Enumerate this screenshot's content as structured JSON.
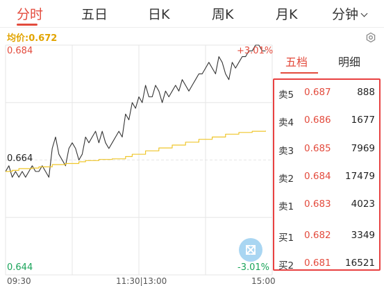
{
  "tabs": [
    {
      "label": "分时",
      "active": true
    },
    {
      "label": "五日",
      "active": false
    },
    {
      "label": "日K",
      "active": false
    },
    {
      "label": "周K",
      "active": false
    },
    {
      "label": "月K",
      "active": false
    },
    {
      "label": "分钟",
      "active": false
    }
  ],
  "avg_price_label": "均价:0.672",
  "chart": {
    "price_high": "0.684",
    "price_prev_close": "0.664",
    "price_low": "0.644",
    "pct_high": "+3.01%",
    "pct_low": "-3.01%",
    "times": [
      "09:30",
      "11:30|13:00",
      "15:00"
    ]
  },
  "chart_data": {
    "type": "line",
    "ylim": [
      0.644,
      0.684
    ],
    "reference_price": 0.664,
    "x_range_minutes": [
      0,
      240
    ],
    "series": [
      {
        "color": "#333333",
        "points": [
          [
            0,
            0.662
          ],
          [
            3,
            0.663
          ],
          [
            6,
            0.661
          ],
          [
            9,
            0.662
          ],
          [
            12,
            0.661
          ],
          [
            15,
            0.662
          ],
          [
            18,
            0.661
          ],
          [
            21,
            0.662
          ],
          [
            24,
            0.663
          ],
          [
            27,
            0.662
          ],
          [
            30,
            0.662
          ],
          [
            33,
            0.663
          ],
          [
            36,
            0.662
          ],
          [
            39,
            0.661
          ],
          [
            42,
            0.666
          ],
          [
            45,
            0.668
          ],
          [
            48,
            0.665
          ],
          [
            51,
            0.664
          ],
          [
            54,
            0.663
          ],
          [
            57,
            0.666
          ],
          [
            60,
            0.667
          ],
          [
            63,
            0.666
          ],
          [
            66,
            0.664
          ],
          [
            69,
            0.665
          ],
          [
            72,
            0.668
          ],
          [
            75,
            0.667
          ],
          [
            78,
            0.668
          ],
          [
            81,
            0.669
          ],
          [
            84,
            0.667
          ],
          [
            87,
            0.669
          ],
          [
            90,
            0.667
          ],
          [
            93,
            0.666
          ],
          [
            96,
            0.667
          ],
          [
            99,
            0.668
          ],
          [
            102,
            0.669
          ],
          [
            105,
            0.668
          ],
          [
            108,
            0.672
          ],
          [
            111,
            0.671
          ],
          [
            114,
            0.674
          ],
          [
            117,
            0.673
          ],
          [
            120,
            0.675
          ],
          [
            123,
            0.674
          ],
          [
            126,
            0.677
          ],
          [
            129,
            0.675
          ],
          [
            132,
            0.675
          ],
          [
            135,
            0.677
          ],
          [
            138,
            0.676
          ],
          [
            141,
            0.674
          ],
          [
            144,
            0.676
          ],
          [
            147,
            0.675
          ],
          [
            150,
            0.676
          ],
          [
            153,
            0.677
          ],
          [
            156,
            0.676
          ],
          [
            159,
            0.678
          ],
          [
            162,
            0.677
          ],
          [
            165,
            0.676
          ],
          [
            168,
            0.677
          ],
          [
            171,
            0.678
          ],
          [
            174,
            0.679
          ],
          [
            177,
            0.679
          ],
          [
            180,
            0.68
          ],
          [
            183,
            0.681
          ],
          [
            186,
            0.68
          ],
          [
            189,
            0.679
          ],
          [
            192,
            0.682
          ],
          [
            195,
            0.681
          ],
          [
            198,
            0.679
          ],
          [
            201,
            0.678
          ],
          [
            204,
            0.681
          ],
          [
            207,
            0.68
          ],
          [
            210,
            0.681
          ],
          [
            213,
            0.682
          ],
          [
            216,
            0.682
          ],
          [
            219,
            0.683
          ],
          [
            222,
            0.683
          ],
          [
            225,
            0.684
          ],
          [
            228,
            0.684
          ],
          [
            231,
            0.683
          ],
          [
            234,
            0.683
          ]
        ]
      },
      {
        "color": "#efc62b",
        "points": [
          [
            0,
            0.662
          ],
          [
            6,
            0.6622
          ],
          [
            12,
            0.6625
          ],
          [
            24,
            0.6626
          ],
          [
            30,
            0.6628
          ],
          [
            42,
            0.6632
          ],
          [
            54,
            0.6634
          ],
          [
            66,
            0.6637
          ],
          [
            72,
            0.6639
          ],
          [
            84,
            0.6641
          ],
          [
            96,
            0.6642
          ],
          [
            108,
            0.6646
          ],
          [
            114,
            0.665
          ],
          [
            126,
            0.6656
          ],
          [
            138,
            0.6661
          ],
          [
            150,
            0.6666
          ],
          [
            162,
            0.6671
          ],
          [
            174,
            0.6676
          ],
          [
            186,
            0.668
          ],
          [
            198,
            0.6685
          ],
          [
            210,
            0.6688
          ],
          [
            222,
            0.669
          ],
          [
            234,
            0.6691
          ]
        ]
      }
    ]
  },
  "side_tabs": [
    {
      "label": "五档",
      "active": true
    },
    {
      "label": "明细",
      "active": false
    }
  ],
  "order_book": [
    {
      "label": "卖5",
      "price": "0.687",
      "volume": "888"
    },
    {
      "label": "卖4",
      "price": "0.686",
      "volume": "1677"
    },
    {
      "label": "卖3",
      "price": "0.685",
      "volume": "7969"
    },
    {
      "label": "卖2",
      "price": "0.684",
      "volume": "17479"
    },
    {
      "label": "卖1",
      "price": "0.683",
      "volume": "4023"
    },
    {
      "label": "买1",
      "price": "0.682",
      "volume": "3349"
    },
    {
      "label": "买2",
      "price": "0.681",
      "volume": "16521"
    }
  ],
  "colors": {
    "accent": "#e34b3d",
    "down": "#1aa45a",
    "avg_line": "#efc62b",
    "book_border": "#e84040",
    "expand_button": "#a9d6f2"
  }
}
